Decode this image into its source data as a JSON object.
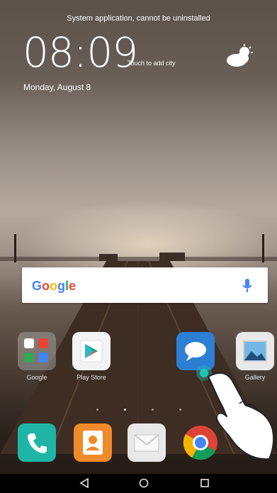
{
  "status": {
    "banner": "System application, cannot be uninstalled"
  },
  "clock_widget": {
    "time": "08:09",
    "city_hint": "Touch to add city",
    "date": "Monday, August 8",
    "weather_icon": "partly-cloudy-icon"
  },
  "search": {
    "logo": "Google",
    "mic_icon": "mic-icon"
  },
  "apps": [
    {
      "label": "Google",
      "icon": "google-folder-icon"
    },
    {
      "label": "Play Store",
      "icon": "play-store-icon"
    },
    {
      "label": "",
      "icon": "messages-icon"
    },
    {
      "label": "Gallery",
      "icon": "gallery-icon"
    }
  ],
  "dock": [
    {
      "icon": "phone-icon"
    },
    {
      "icon": "contacts-icon"
    },
    {
      "icon": "email-icon"
    },
    {
      "icon": "chrome-icon"
    }
  ],
  "navigation": {
    "back": "back-icon",
    "home": "home-icon",
    "recents": "recents-icon"
  },
  "colors": {
    "phone": "#1fb5a6",
    "contacts": "#f08a2a",
    "email": "#e8e8e8",
    "messages": "#2d7fd3",
    "tap_indicator": "#1fc7b1"
  }
}
